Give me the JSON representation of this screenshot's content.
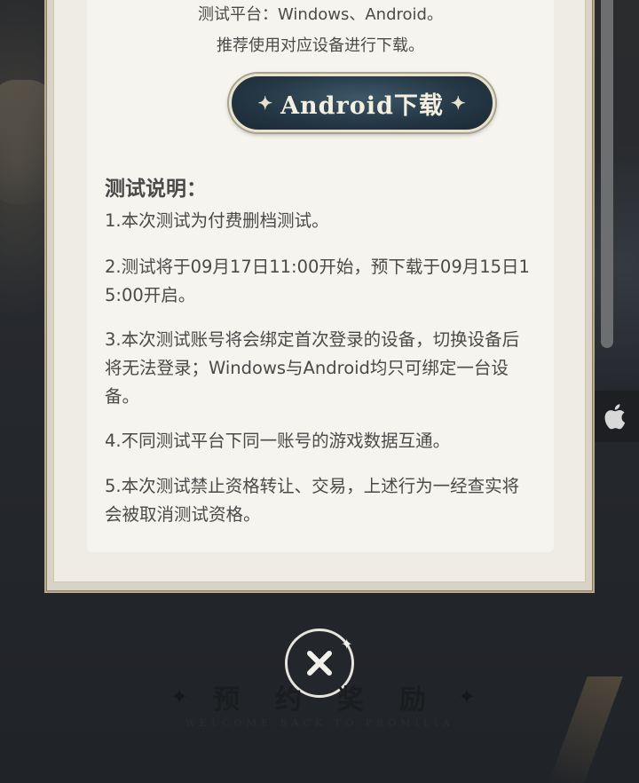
{
  "modal": {
    "platform_text": "测试平台：Windows、Android。",
    "recommend_text": "推荐使用对应设备进行下载。",
    "android_button_label": "Android下载",
    "section_title": "测试说明：",
    "notes": [
      "1.本次测试为付费删档测试。",
      "2.测试将于09月17日11:00开始，预下载于09月15日15:00开启。",
      "3.本次测试账号将会绑定首次登录的设备，切换设备后将无法登录；Windows与Android均只可绑定一台设备。",
      "4.不同测试平台下同一账号的游戏数据互通。",
      "5.本次测试禁止资格转让、交易，上述行为一经查实将会被取消测试资格。"
    ]
  },
  "close": {
    "icon": "close-icon"
  },
  "reward": {
    "title": "预约奖励",
    "subtitle": "WELCOME BACK TO PROMILIA"
  },
  "side": {
    "icon": "apple-icon"
  },
  "colors": {
    "text": "#4a4a4a",
    "panel": "#f6f4ee",
    "button_bg": "#253846",
    "page_bg": "#23262b"
  }
}
